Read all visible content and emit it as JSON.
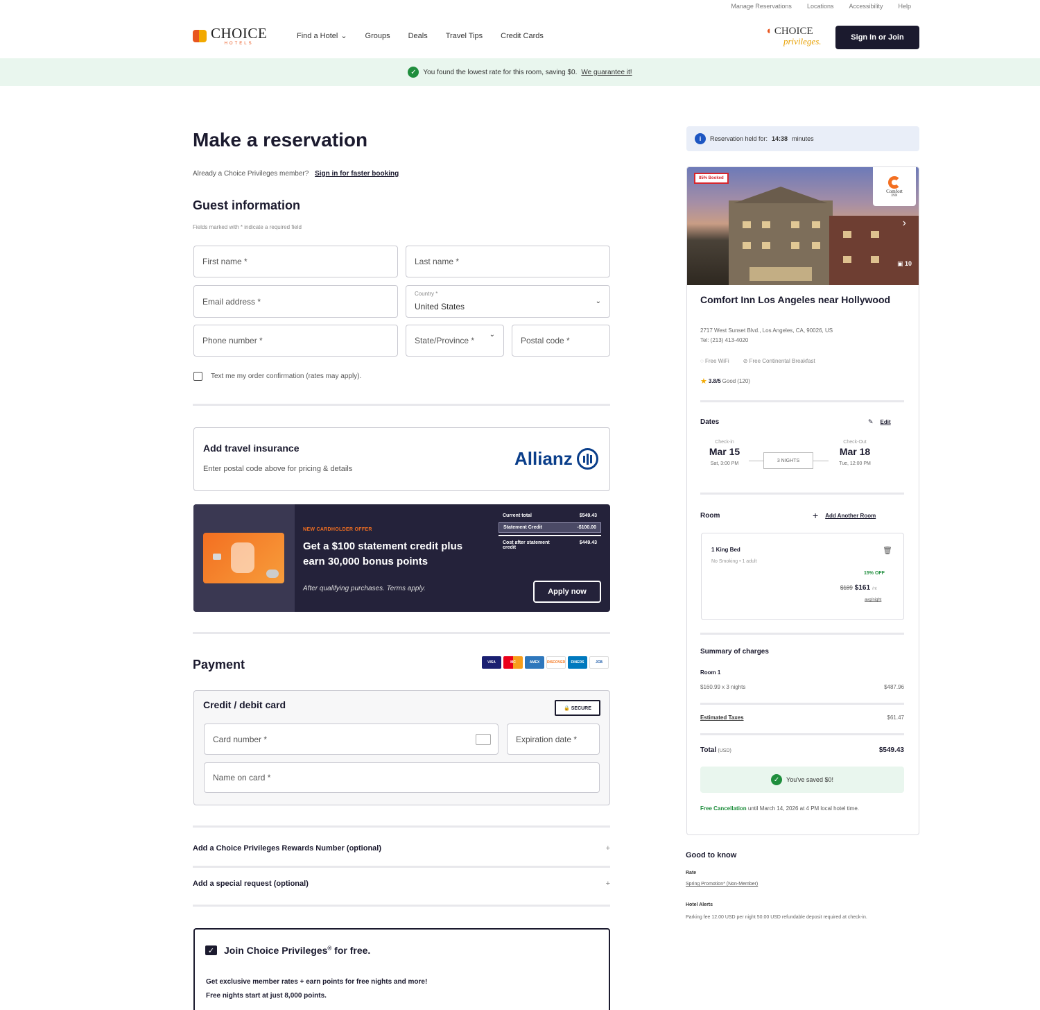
{
  "utility_nav": [
    "Manage Reservations",
    "Locations",
    "Accessibility",
    "Help"
  ],
  "brand": {
    "name": "CHOICE",
    "sub": "HOTELS",
    "privileges_1": "CHOICE",
    "privileges_2": "privileges.",
    "accent": "#e8561e"
  },
  "nav": {
    "find_hotel": "Find a Hotel",
    "groups": "Groups",
    "deals": "Deals",
    "travel_tips": "Travel Tips",
    "credit_cards": "Credit Cards"
  },
  "signin_button": "Sign In or Join",
  "banner": {
    "text": "You found the lowest rate for this room, saving $0.",
    "link": "We guarantee it!"
  },
  "page_title": "Make a reservation",
  "already_member": {
    "text": "Already a Choice Privileges member?",
    "link": "Sign in for faster booking"
  },
  "guest": {
    "title": "Guest information",
    "required_note": "Fields marked with * indicate a required field",
    "first_name": "First name *",
    "last_name": "Last name *",
    "email": "Email address *",
    "country_label": "Country *",
    "country_value": "United States",
    "phone": "Phone number *",
    "state": "State/Province *",
    "postal": "Postal code *",
    "text_me": "Text me my order confirmation (rates may apply)."
  },
  "insurance": {
    "title": "Add travel insurance",
    "subtitle": "Enter postal code above for pricing & details",
    "provider": "Allianz"
  },
  "promo": {
    "tag": "NEW CARDHOLDER OFFER",
    "headline": "Get a $100 statement credit plus earn 30,000 bonus points",
    "fine": "After qualifying purchases. Terms apply.",
    "rows": [
      {
        "label": "Current total",
        "value": "$549.43"
      },
      {
        "label": "Statement Credit",
        "value": "-$100.00"
      },
      {
        "label": "Cost after statement credit",
        "value": "$449.43"
      }
    ],
    "apply": "Apply now"
  },
  "payment": {
    "title": "Payment",
    "card_title": "Credit / debit card",
    "secure": "🔒 SECURE",
    "card_number": "Card number *",
    "expiration": "Expiration date *",
    "name_on_card": "Name on card *",
    "icons": [
      "VISA",
      "MC",
      "AMEX",
      "DISCOVER",
      "DINERS",
      "JCB"
    ]
  },
  "accordions": {
    "rewards": "Add a Choice Privileges Rewards Number (optional)",
    "special": "Add a special request (optional)",
    "plus": "+"
  },
  "join": {
    "title": "Join Choice Privileges",
    "reg": "®",
    "title_suffix": " for free.",
    "line1": "Get exclusive member rates + earn points for free nights and more!",
    "line2": "Free nights start at just 8,000 points."
  },
  "held": {
    "prefix": "Reservation held for:",
    "time": "14:38",
    "suffix": "minutes"
  },
  "hotel": {
    "booked": "85% Booked",
    "brand": "Comfort",
    "brand_sub": "INN",
    "photo_count": "10",
    "name": "Comfort Inn Los Angeles near Hollywood",
    "address": "2717 West Sunset Blvd., Los Angeles, CA, 90026, US",
    "phone": "Tel: (213) 413-4020",
    "amenity1": "Free WiFi",
    "amenity2": "Free Continental Breakfast",
    "rating": "3.8/5",
    "rating_word": "Good",
    "reviews": "(120)"
  },
  "dates": {
    "title": "Dates",
    "edit": "Edit",
    "checkin_label": "Check-in",
    "checkin_date": "Mar 15",
    "checkin_time": "Sat, 3:00 PM",
    "nights": "3 NIGHTS",
    "checkout_label": "Check-Out",
    "checkout_date": "Mar 18",
    "checkout_time": "Tue, 12:00 PM"
  },
  "room": {
    "title": "Room",
    "add": "Add Another Room",
    "name": "1 King Bed",
    "details": "No Smoking • 1 adult",
    "discount": "15% OFF",
    "old_price": "$189",
    "price": "$161",
    "unit": "/nt",
    "avg": "avg/night"
  },
  "charges": {
    "title": "Summary of charges",
    "room_label": "Room 1",
    "nights_label": "$160.99 x 3 nights",
    "nights_value": "$487.96",
    "taxes_label": "Estimated Taxes",
    "taxes_value": "$61.47",
    "total_label": "Total",
    "currency": "(USD)",
    "total_value": "$549.43",
    "saved": "You've saved $0!",
    "cancel_bold": "Free Cancellation",
    "cancel_text": " until March 14, 2026 at 4 PM local hotel time."
  },
  "good_to_know": {
    "title": "Good to know",
    "rate_label": "Rate",
    "rate_value": "Spring Promotion* (Non-Member)",
    "alerts_label": "Hotel Alerts",
    "alerts_text": "Parking fee 12.00 USD per night 50.00 USD refundable deposit required at check-in."
  }
}
